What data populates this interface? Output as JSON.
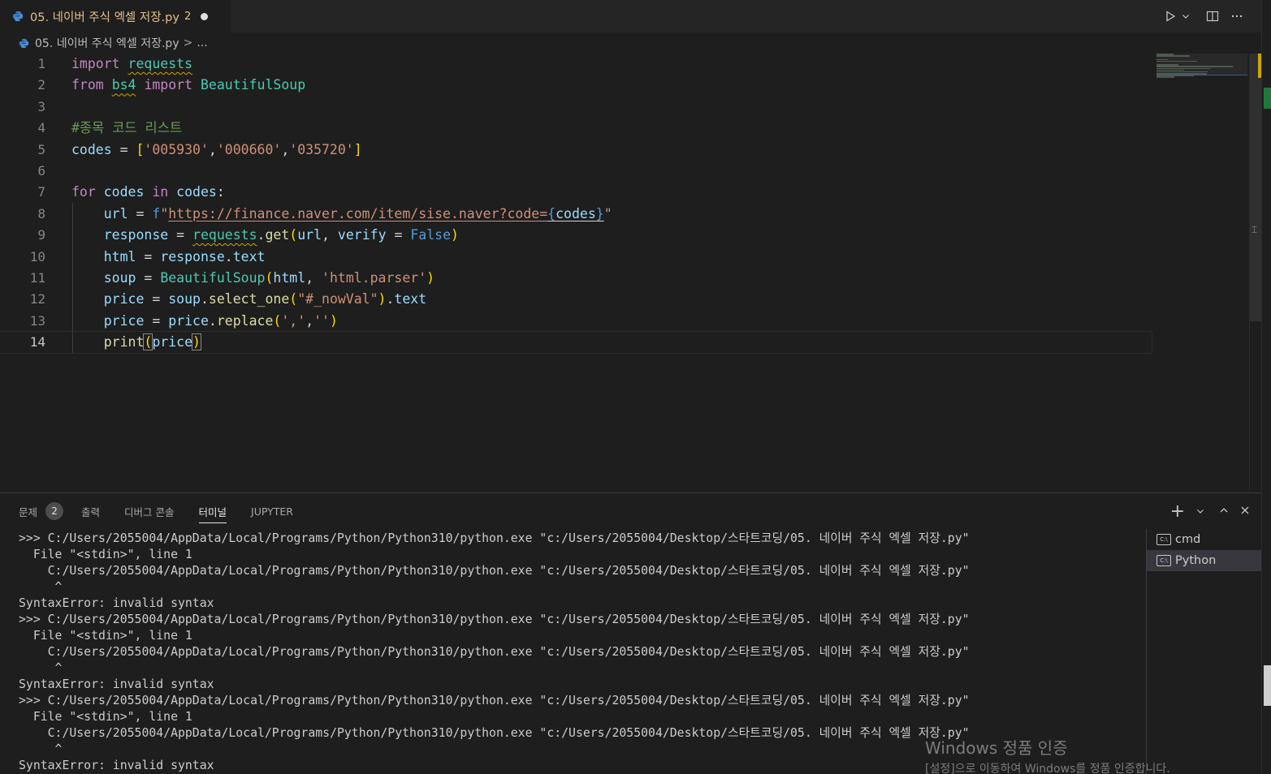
{
  "tab": {
    "title": "05. 네이버 주식 엑셀 저장.py",
    "problem_count": "2",
    "dirty": true
  },
  "toolbar": {
    "run_icon": "play-icon",
    "split_icon": "split-editor-icon",
    "more_icon": "ellipsis-icon"
  },
  "breadcrumb": {
    "file": "05. 네이버 주식 엑셀 저장.py",
    "separator": ">",
    "symbol": "..."
  },
  "editor": {
    "line_numbers": [
      "1",
      "2",
      "3",
      "4",
      "5",
      "6",
      "7",
      "8",
      "9",
      "10",
      "11",
      "12",
      "13",
      "14"
    ],
    "active_line": 14,
    "code_lines": [
      "import requests",
      "from bs4 import BeautifulSoup",
      "",
      "#종목 코드 리스트",
      "codes = ['005930','000660','035720']",
      "",
      "for codes in codes:",
      "    url = f\"https://finance.naver.com/item/sise.naver?code={codes}\"",
      "    response = requests.get(url, verify = False)",
      "    html = response.text",
      "    soup = BeautifulSoup(html, 'html.parser')",
      "    price = soup.select_one(\"#_nowVal\").text",
      "    price = price.replace(',','')",
      "    print(price)"
    ]
  },
  "panel": {
    "tabs": [
      {
        "label": "문제",
        "badge": "2"
      },
      {
        "label": "출력"
      },
      {
        "label": "디버그 콘솔"
      },
      {
        "label": "터미널",
        "active": true
      },
      {
        "label": "JUPYTER"
      }
    ],
    "actions": {
      "add": "+",
      "dropdown": "⌄",
      "maximize": "^",
      "close": "×"
    },
    "terminal_lines": [
      ">>> C:/Users/2055004/AppData/Local/Programs/Python/Python310/python.exe \"c:/Users/2055004/Desktop/스타트코딩/05. 네이버 주식 엑셀 저장.py\"",
      "  File \"<stdin>\", line 1",
      "    C:/Users/2055004/AppData/Local/Programs/Python/Python310/python.exe \"c:/Users/2055004/Desktop/스타트코딩/05. 네이버 주식 엑셀 저장.py\"",
      "     ^",
      "SyntaxError: invalid syntax",
      ">>> C:/Users/2055004/AppData/Local/Programs/Python/Python310/python.exe \"c:/Users/2055004/Desktop/스타트코딩/05. 네이버 주식 엑셀 저장.py\"",
      "  File \"<stdin>\", line 1",
      "    C:/Users/2055004/AppData/Local/Programs/Python/Python310/python.exe \"c:/Users/2055004/Desktop/스타트코딩/05. 네이버 주식 엑셀 저장.py\"",
      "     ^",
      "SyntaxError: invalid syntax",
      ">>> C:/Users/2055004/AppData/Local/Programs/Python/Python310/python.exe \"c:/Users/2055004/Desktop/스타트코딩/05. 네이버 주식 엑셀 저장.py\"",
      "  File \"<stdin>\", line 1",
      "    C:/Users/2055004/AppData/Local/Programs/Python/Python310/python.exe \"c:/Users/2055004/Desktop/스타트코딩/05. 네이버 주식 엑셀 저장.py\"",
      "     ^",
      "SyntaxError: invalid syntax"
    ],
    "terminal_instances": [
      {
        "label": "cmd"
      },
      {
        "label": "Python",
        "selected": true
      }
    ]
  },
  "watermark": {
    "title": "Windows 정품 인증",
    "subtitle": "[설정]으로 이동하여 Windows를 정품 인증합니다."
  },
  "colors": {
    "tab_title": "#e2c08d",
    "keyword": "#c586c0",
    "builtin": "#569cd6",
    "variable": "#9cdcfe",
    "class": "#4ec9b0",
    "function": "#dcdcaa",
    "string": "#ce9178",
    "comment": "#6a9955",
    "warning": "#cca700"
  }
}
